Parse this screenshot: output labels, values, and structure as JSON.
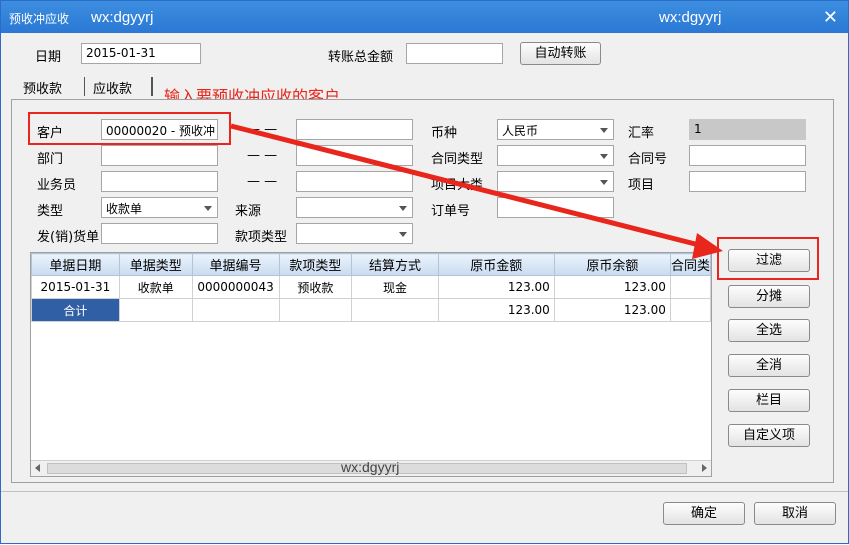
{
  "window": {
    "title": "预收冲应收",
    "watermark": "wx:dgyyrj"
  },
  "header": {
    "date_label": "日期",
    "date_value": "2015-01-31",
    "total_label": "转账总金额",
    "total_value": "",
    "auto_button": "自动转账"
  },
  "tabs": [
    {
      "label": "预收款"
    },
    {
      "label": "应收款"
    }
  ],
  "annotation": "输入要预收冲应收的客户",
  "form": {
    "customer_label": "客户",
    "customer_value": "00000020 - 预收冲",
    "dept_label": "部门",
    "salesman_label": "业务员",
    "type_label": "类型",
    "type_value": "收款单",
    "invoice_label": "发(销)货单",
    "dash": "— —",
    "source_label": "来源",
    "fund_type_label": "款项类型",
    "currency_label": "币种",
    "currency_value": "人民币",
    "contract_type_label": "合同类型",
    "project_cat_label": "项目大类",
    "order_label": "订单号",
    "rate_label": "汇率",
    "rate_value": "1",
    "contract_no_label": "合同号",
    "project_label": "项目"
  },
  "table": {
    "columns": [
      "单据日期",
      "单据类型",
      "单据编号",
      "款项类型",
      "结算方式",
      "原币金额",
      "原币余额",
      "合同类"
    ],
    "rows": [
      [
        "2015-01-31",
        "收款单",
        "0000000043",
        "预收款",
        "现金",
        "123.00",
        "123.00",
        ""
      ]
    ],
    "total": {
      "label": "合计",
      "amount": "123.00",
      "balance": "123.00"
    }
  },
  "side_buttons": {
    "filter": "过滤",
    "split": "分摊",
    "select_all": "全选",
    "deselect_all": "全消",
    "columns": "栏目",
    "custom": "自定义项"
  },
  "footer": {
    "ok": "确定",
    "cancel": "取消"
  },
  "colors": {
    "title_bar": "#2a78d4",
    "annotation": "#e8261c",
    "total_cell": "#315fa6"
  }
}
